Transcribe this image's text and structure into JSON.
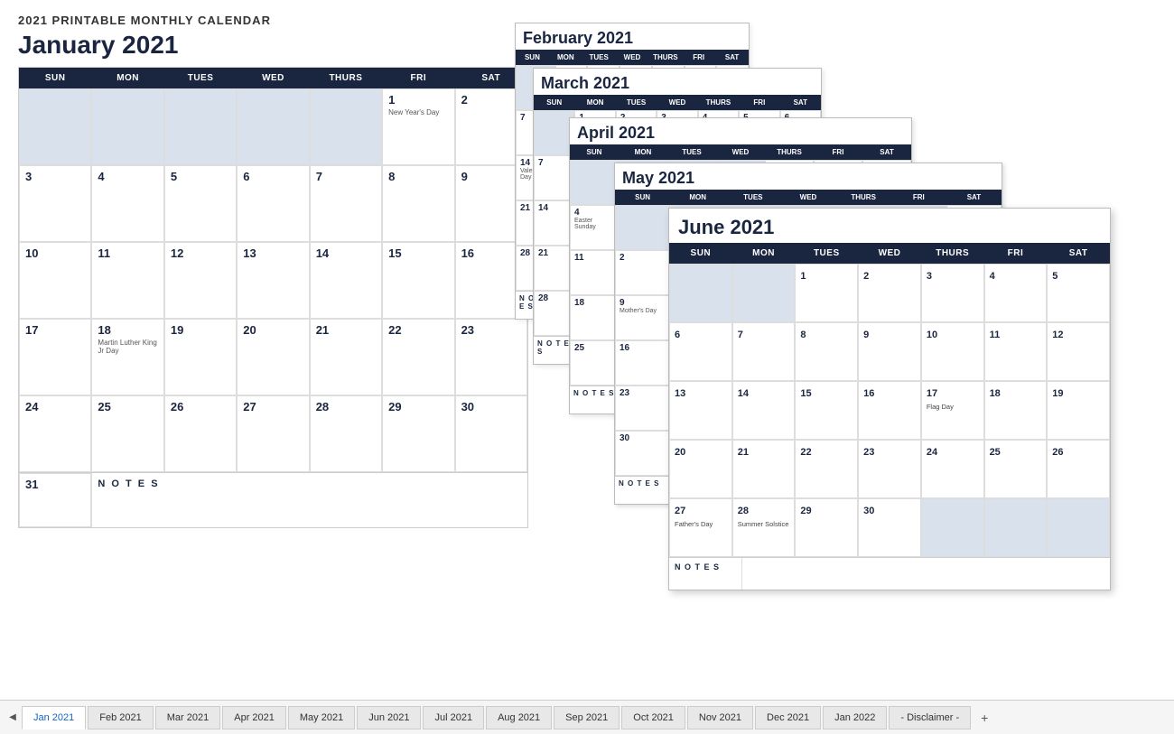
{
  "app": {
    "title": "2021 PRINTABLE MONTHLY CALENDAR"
  },
  "january": {
    "title": "January 2021",
    "headers": [
      "SUN",
      "MON",
      "TUES",
      "WED",
      "THURS",
      "FRI",
      "SAT"
    ],
    "weeks": [
      [
        {
          "num": "",
          "shaded": true,
          "holiday": ""
        },
        {
          "num": "",
          "shaded": true,
          "holiday": ""
        },
        {
          "num": "",
          "shaded": true,
          "holiday": ""
        },
        {
          "num": "",
          "shaded": true,
          "holiday": ""
        },
        {
          "num": "",
          "shaded": true,
          "holiday": ""
        },
        {
          "num": "1",
          "shaded": false,
          "holiday": "New Year's Day"
        },
        {
          "num": "2",
          "shaded": false,
          "holiday": ""
        }
      ],
      [
        {
          "num": "3",
          "shaded": false,
          "holiday": ""
        },
        {
          "num": "4",
          "shaded": false,
          "holiday": ""
        },
        {
          "num": "5",
          "shaded": false,
          "holiday": ""
        },
        {
          "num": "6",
          "shaded": false,
          "holiday": ""
        },
        {
          "num": "7",
          "shaded": false,
          "holiday": ""
        },
        {
          "num": "8",
          "shaded": false,
          "holiday": ""
        },
        {
          "num": "9",
          "shaded": false,
          "holiday": ""
        }
      ],
      [
        {
          "num": "10",
          "shaded": false,
          "holiday": ""
        },
        {
          "num": "11",
          "shaded": false,
          "holiday": ""
        },
        {
          "num": "12",
          "shaded": false,
          "holiday": ""
        },
        {
          "num": "13",
          "shaded": false,
          "holiday": ""
        },
        {
          "num": "14",
          "shaded": false,
          "holiday": ""
        },
        {
          "num": "15",
          "shaded": false,
          "holiday": ""
        },
        {
          "num": "16",
          "shaded": false,
          "holiday": ""
        }
      ],
      [
        {
          "num": "17",
          "shaded": false,
          "holiday": ""
        },
        {
          "num": "18",
          "shaded": false,
          "holiday": "Martin Luther King Jr Day"
        },
        {
          "num": "19",
          "shaded": false,
          "holiday": ""
        },
        {
          "num": "20",
          "shaded": false,
          "holiday": ""
        },
        {
          "num": "21",
          "shaded": false,
          "holiday": ""
        },
        {
          "num": "22",
          "shaded": false,
          "holiday": ""
        },
        {
          "num": "23",
          "shaded": false,
          "holiday": ""
        }
      ],
      [
        {
          "num": "24",
          "shaded": false,
          "holiday": ""
        },
        {
          "num": "25",
          "shaded": false,
          "holiday": ""
        },
        {
          "num": "26",
          "shaded": false,
          "holiday": ""
        },
        {
          "num": "27",
          "shaded": false,
          "holiday": ""
        },
        {
          "num": "28",
          "shaded": false,
          "holiday": ""
        },
        {
          "num": "29",
          "shaded": false,
          "holiday": ""
        },
        {
          "num": "30",
          "shaded": false,
          "holiday": ""
        }
      ]
    ],
    "last_row": {
      "num": "31",
      "notes_label": "N O T E S"
    }
  },
  "february": {
    "title": "February 2021",
    "headers": [
      "SUN",
      "MON",
      "TUES",
      "WED",
      "THURS",
      "FRI",
      "SAT"
    ]
  },
  "march": {
    "title": "March 2021",
    "headers": [
      "SUN",
      "MON",
      "TUES",
      "WED",
      "THURS",
      "FRI",
      "SAT"
    ]
  },
  "april": {
    "title": "April 2021",
    "headers": [
      "SUN",
      "MON",
      "TUES",
      "WED",
      "THURS",
      "FRI",
      "SAT"
    ]
  },
  "may": {
    "title": "May 2021",
    "headers": [
      "SUN",
      "MON",
      "TUES",
      "WED",
      "THURS",
      "FRI",
      "SAT"
    ]
  },
  "june": {
    "title": "June 2021",
    "headers": [
      "SUN",
      "MON",
      "TUES",
      "WED",
      "THURS",
      "FRI",
      "SAT"
    ],
    "weeks": [
      [
        {
          "num": "",
          "shaded": true
        },
        {
          "num": "",
          "shaded": true
        },
        {
          "num": "1",
          "shaded": false,
          "holiday": ""
        },
        {
          "num": "2",
          "shaded": false,
          "holiday": ""
        },
        {
          "num": "3",
          "shaded": false,
          "holiday": ""
        },
        {
          "num": "4",
          "shaded": false,
          "holiday": ""
        },
        {
          "num": "5",
          "shaded": false,
          "holiday": ""
        }
      ],
      [
        {
          "num": "6",
          "shaded": false,
          "holiday": ""
        },
        {
          "num": "7",
          "shaded": false,
          "holiday": ""
        },
        {
          "num": "8",
          "shaded": false,
          "holiday": ""
        },
        {
          "num": "9",
          "shaded": false,
          "holiday": ""
        },
        {
          "num": "10",
          "shaded": false,
          "holiday": ""
        },
        {
          "num": "11",
          "shaded": false,
          "holiday": ""
        },
        {
          "num": "12",
          "shaded": false,
          "holiday": ""
        }
      ],
      [
        {
          "num": "13",
          "shaded": false,
          "holiday": ""
        },
        {
          "num": "14",
          "shaded": false,
          "holiday": ""
        },
        {
          "num": "15",
          "shaded": false,
          "holiday": ""
        },
        {
          "num": "16",
          "shaded": false,
          "holiday": ""
        },
        {
          "num": "17",
          "shaded": false,
          "holiday": "Flag Day"
        },
        {
          "num": "18",
          "shaded": false,
          "holiday": ""
        },
        {
          "num": "19",
          "shaded": false,
          "holiday": ""
        }
      ],
      [
        {
          "num": "20",
          "shaded": false,
          "holiday": ""
        },
        {
          "num": "21",
          "shaded": false,
          "holiday": ""
        },
        {
          "num": "22",
          "shaded": false,
          "holiday": ""
        },
        {
          "num": "23",
          "shaded": false,
          "holiday": ""
        },
        {
          "num": "24",
          "shaded": false,
          "holiday": ""
        },
        {
          "num": "25",
          "shaded": false,
          "holiday": ""
        },
        {
          "num": "26",
          "shaded": false,
          "holiday": ""
        }
      ],
      [
        {
          "num": "27",
          "shaded": false,
          "holiday": "Father's Day"
        },
        {
          "num": "28",
          "shaded": false,
          "holiday": "Summer Solstice"
        },
        {
          "num": "29",
          "shaded": false,
          "holiday": ""
        },
        {
          "num": "30",
          "shaded": false,
          "holiday": ""
        },
        {
          "num": "",
          "shaded": true
        },
        {
          "num": "",
          "shaded": true
        },
        {
          "num": "",
          "shaded": true
        }
      ]
    ],
    "notes_label": "N O T E S"
  },
  "tabs": {
    "items": [
      {
        "label": "Jan 2021",
        "active": true
      },
      {
        "label": "Feb 2021",
        "active": false
      },
      {
        "label": "Mar 2021",
        "active": false
      },
      {
        "label": "Apr 2021",
        "active": false
      },
      {
        "label": "May 2021",
        "active": false
      },
      {
        "label": "Jun 2021",
        "active": false
      },
      {
        "label": "Jul 2021",
        "active": false
      },
      {
        "label": "Aug 2021",
        "active": false
      },
      {
        "label": "Sep 2021",
        "active": false
      },
      {
        "label": "Oct 2021",
        "active": false
      },
      {
        "label": "Nov 2021",
        "active": false
      },
      {
        "label": "Dec 2021",
        "active": false
      },
      {
        "label": "Jan 2022",
        "active": false
      },
      {
        "label": "- Disclaimer -",
        "active": false
      }
    ],
    "add_label": "+"
  }
}
